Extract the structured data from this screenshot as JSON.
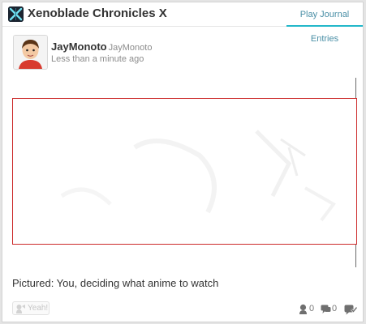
{
  "header": {
    "game_title": "Xenoblade Chronicles X",
    "tab_label": "Play Journal Entries",
    "accent_color": "#22b7c9"
  },
  "post": {
    "user_name": "JayMonoto",
    "user_handle": "JayMonoto",
    "timestamp": "Less than a minute ago",
    "caption": "Pictured: You, deciding what anime to watch",
    "frame_color": "#cc2a2a"
  },
  "footer": {
    "yeah_label": "Yeah!",
    "empathy_count": "0",
    "comment_count": "0",
    "icons": [
      "yeah-icon",
      "empathy-icon",
      "comment-icon",
      "spoiler-icon"
    ]
  }
}
